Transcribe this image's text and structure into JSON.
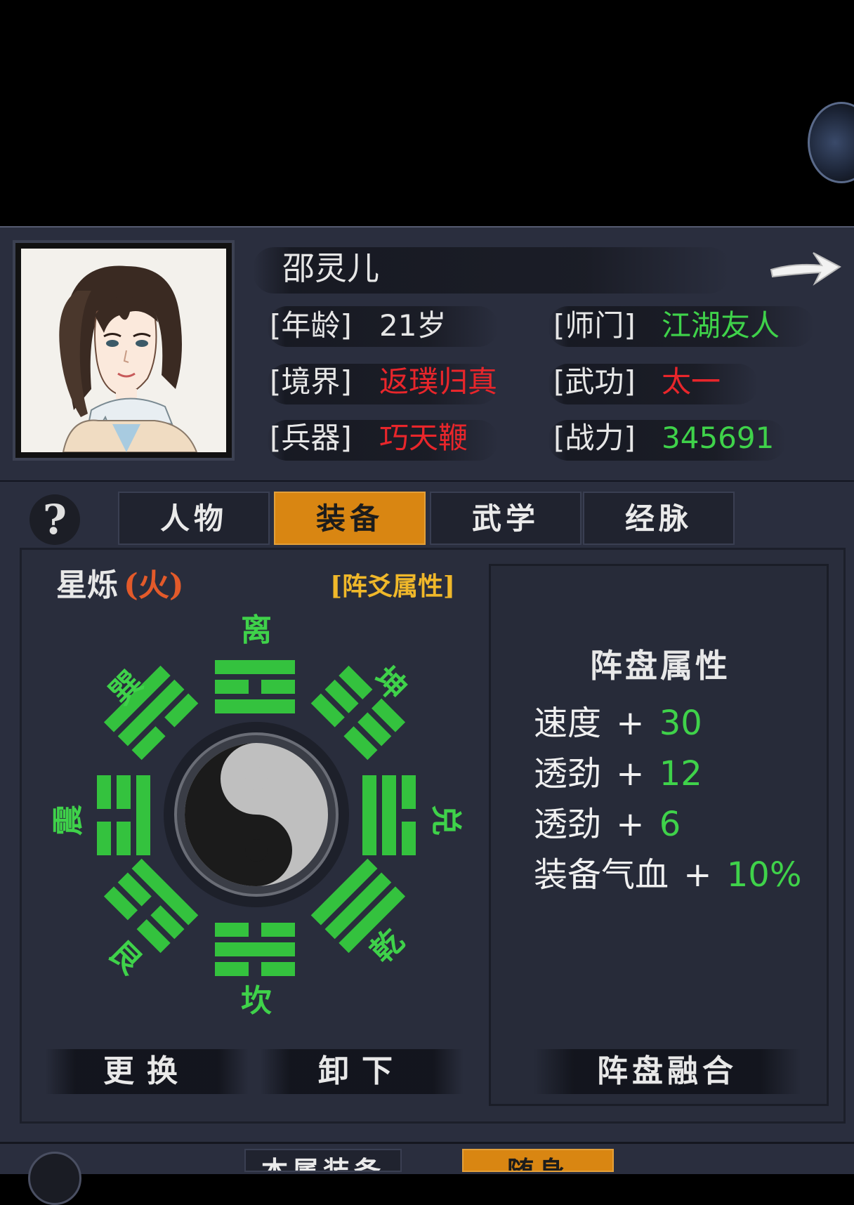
{
  "character": {
    "name": "邵灵儿",
    "age_label": "[年龄]",
    "age_value": "21岁",
    "realm_label": "[境界]",
    "realm_value": "返璞归真",
    "weapon_label": "[兵器]",
    "weapon_value": "巧天鞭",
    "sect_label": "[师门]",
    "sect_value": "江湖友人",
    "martial_label": "[武功]",
    "martial_value": "太一",
    "power_label": "[战力]",
    "power_value": "345691"
  },
  "tabs": [
    {
      "label": "人物",
      "active": false
    },
    {
      "label": "装备",
      "active": true
    },
    {
      "label": "武学",
      "active": false
    },
    {
      "label": "经脉",
      "active": false
    }
  ],
  "help": {
    "label": "?"
  },
  "formation": {
    "name": "星烁",
    "element_open": "(",
    "element": "火",
    "element_close": ")",
    "attr_link": "[阵爻属性]",
    "trigrams": {
      "li": "离",
      "kun": "坤",
      "dui": "兑",
      "qian": "乾",
      "kan": "坎",
      "gen": "艮",
      "zhen": "震",
      "xun": "巽"
    },
    "buttons": {
      "replace": "更换",
      "unload": "卸下",
      "fuse": "阵盘融合"
    }
  },
  "panel": {
    "title": "阵盘属性",
    "stats": [
      {
        "name": "速度",
        "plus": "+",
        "value": "30"
      },
      {
        "name": "透劲",
        "plus": "+",
        "value": "12"
      },
      {
        "name": "透劲",
        "plus": "+",
        "value": "6"
      },
      {
        "name": "装备气血",
        "plus": "+",
        "value": "10%"
      }
    ]
  },
  "bottom_tabs": [
    {
      "label": "本属装备"
    },
    {
      "label": "随身"
    }
  ],
  "colors": {
    "accent": "#d98612",
    "good": "#3fd24a",
    "bad": "#e8262b"
  }
}
